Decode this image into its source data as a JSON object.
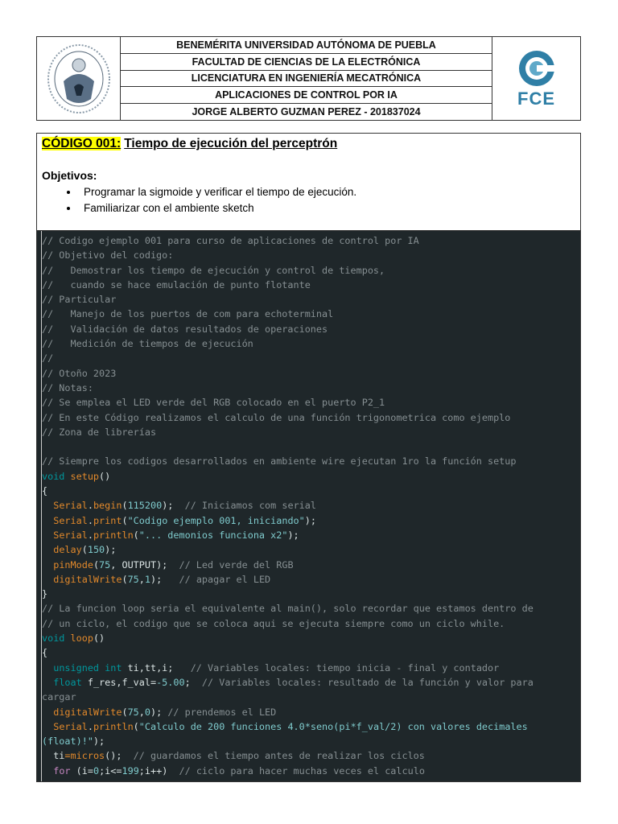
{
  "header": {
    "university": "BENEMÉRITA UNIVERSIDAD AUTÓNOMA DE PUEBLA",
    "faculty": "FACULTAD DE CIENCIAS DE LA ELECTRÓNICA",
    "program": "LICENCIATURA EN INGENIERÍA MECATRÓNICA",
    "course": "APLICACIONES DE CONTROL POR IA",
    "student": "JORGE ALBERTO GUZMAN PEREZ - 201837024",
    "right_logo_text": "FCE"
  },
  "section": {
    "code_label": "CÓDIGO 001:",
    "title": "Tiempo de ejecución del perceptrón",
    "objectives_heading": "Objetivos:",
    "objectives": [
      "Programar la sigmoide y verificar el tiempo de ejecución.",
      "Familiarizar con el ambiente sketch"
    ]
  },
  "code": {
    "lines": [
      [
        [
          "c",
          "// Codigo ejemplo 001 para curso de aplicaciones de control por IA"
        ]
      ],
      [
        [
          "c",
          "// Objetivo del codigo:"
        ]
      ],
      [
        [
          "c",
          "//   Demostrar los tiempo de ejecución y control de tiempos,"
        ]
      ],
      [
        [
          "c",
          "//   cuando se hace emulación de punto flotante"
        ]
      ],
      [
        [
          "c",
          "// Particular"
        ]
      ],
      [
        [
          "c",
          "//   Manejo de los puertos de com para echoterminal"
        ]
      ],
      [
        [
          "c",
          "//   Validación de datos resultados de operaciones"
        ]
      ],
      [
        [
          "c",
          "//   Medición de tiempos de ejecución"
        ]
      ],
      [
        [
          "c",
          "//"
        ]
      ],
      [
        [
          "c",
          "// Otoño 2023"
        ]
      ],
      [
        [
          "c",
          "// Notas:"
        ]
      ],
      [
        [
          "c",
          "// Se emplea el LED verde del RGB colocado en el puerto P2_1"
        ]
      ],
      [
        [
          "c",
          "// En este Código realizamos el calculo de una función trigonometrica como ejemplo"
        ]
      ],
      [
        [
          "c",
          "// Zona de librerías"
        ]
      ],
      [],
      [
        [
          "c",
          "// Siempre los codigos desarrollados en ambiente wire ejecutan 1ro la función setup"
        ]
      ],
      [
        [
          "k",
          "void "
        ],
        [
          "f",
          "setup"
        ],
        [
          "p",
          "()"
        ]
      ],
      [
        [
          "p",
          "{"
        ]
      ],
      [
        [
          "p",
          "  "
        ],
        [
          "f",
          "Serial"
        ],
        [
          "p",
          "."
        ],
        [
          "f",
          "begin"
        ],
        [
          "p",
          "("
        ],
        [
          "n",
          "115200"
        ],
        [
          "p",
          ");  "
        ],
        [
          "c",
          "// Iniciamos com serial"
        ]
      ],
      [
        [
          "p",
          "  "
        ],
        [
          "f",
          "Serial"
        ],
        [
          "p",
          "."
        ],
        [
          "f",
          "print"
        ],
        [
          "p",
          "("
        ],
        [
          "s",
          "\"Codigo ejemplo 001, iniciando\""
        ],
        [
          "p",
          ");"
        ]
      ],
      [
        [
          "p",
          "  "
        ],
        [
          "f",
          "Serial"
        ],
        [
          "p",
          "."
        ],
        [
          "f",
          "println"
        ],
        [
          "p",
          "("
        ],
        [
          "s",
          "\"... demonios funciona x2\""
        ],
        [
          "p",
          ");"
        ]
      ],
      [
        [
          "p",
          "  "
        ],
        [
          "f",
          "delay"
        ],
        [
          "p",
          "("
        ],
        [
          "n",
          "150"
        ],
        [
          "p",
          ");"
        ]
      ],
      [
        [
          "p",
          "  "
        ],
        [
          "f",
          "pinMode"
        ],
        [
          "p",
          "("
        ],
        [
          "n",
          "75"
        ],
        [
          "p",
          ", OUTPUT);  "
        ],
        [
          "c",
          "// Led verde del RGB"
        ]
      ],
      [
        [
          "p",
          "  "
        ],
        [
          "f",
          "digitalWrite"
        ],
        [
          "p",
          "("
        ],
        [
          "n",
          "75"
        ],
        [
          "p",
          ","
        ],
        [
          "n",
          "1"
        ],
        [
          "p",
          ");   "
        ],
        [
          "c",
          "// apagar el LED"
        ]
      ],
      [
        [
          "p",
          "}"
        ]
      ],
      [
        [
          "c",
          "// La funcion loop seria el equivalente al main(), solo recordar que estamos dentro de"
        ]
      ],
      [
        [
          "c",
          "// un ciclo, el codigo que se coloca aqui se ejecuta siempre como un ciclo while."
        ]
      ],
      [
        [
          "k",
          "void "
        ],
        [
          "f",
          "loop"
        ],
        [
          "p",
          "()"
        ]
      ],
      [
        [
          "p",
          "{"
        ]
      ],
      [
        [
          "p",
          "  "
        ],
        [
          "k",
          "unsigned int "
        ],
        [
          "p",
          "ti,tt,i;   "
        ],
        [
          "c",
          "// Variables locales: tiempo inicia - final y contador"
        ]
      ],
      [
        [
          "p",
          "  "
        ],
        [
          "k",
          "float "
        ],
        [
          "p",
          "f_res,f_val="
        ],
        [
          "n",
          "-5.00"
        ],
        [
          "p",
          ";  "
        ],
        [
          "c",
          "// Variables locales: resultado de la función y valor para"
        ]
      ],
      [
        [
          "c",
          "cargar"
        ]
      ],
      [
        [
          "p",
          "  "
        ],
        [
          "f",
          "digitalWrite"
        ],
        [
          "p",
          "("
        ],
        [
          "n",
          "75"
        ],
        [
          "p",
          ","
        ],
        [
          "n",
          "0"
        ],
        [
          "p",
          "); "
        ],
        [
          "c",
          "// prendemos el LED"
        ]
      ],
      [
        [
          "p",
          "  "
        ],
        [
          "f",
          "Serial"
        ],
        [
          "p",
          "."
        ],
        [
          "f",
          "println"
        ],
        [
          "p",
          "("
        ],
        [
          "s",
          "\"Calculo de 200 funciones 4.0*seno(pi*f_val/2) con valores decimales"
        ]
      ],
      [
        [
          "s",
          "(float)!\""
        ],
        [
          "p",
          ");"
        ]
      ],
      [
        [
          "p",
          "  ti"
        ],
        [
          "f",
          "="
        ],
        [
          "f",
          "micros"
        ],
        [
          "p",
          "();  "
        ],
        [
          "c",
          "// guardamos el tiempo antes de realizar los ciclos"
        ]
      ],
      [
        [
          "p",
          "  "
        ],
        [
          "r",
          "for "
        ],
        [
          "p",
          "(i="
        ],
        [
          "n",
          "0"
        ],
        [
          "p",
          ";i<="
        ],
        [
          "n",
          "199"
        ],
        [
          "p",
          ";i++)  "
        ],
        [
          "c",
          "// ciclo para hacer muchas veces el calculo"
        ]
      ]
    ]
  }
}
